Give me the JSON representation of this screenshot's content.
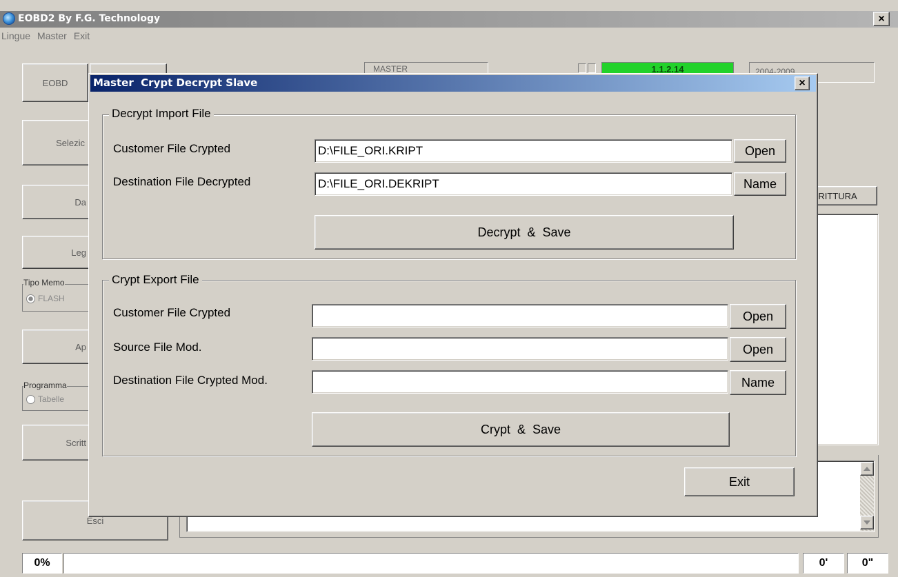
{
  "app": {
    "title": "EOBD2 By F.G. Technology",
    "close_glyph": "×"
  },
  "menu": [
    "Lingue",
    "Master",
    "Exit"
  ],
  "background": {
    "eobd_label": "EOBD",
    "selezio_label": "Selezic",
    "da_label": "Da",
    "leg_label": "Leg",
    "tipo_memoria_label": "Tipo Memo",
    "flash_label": "FLASH",
    "ap_label": "Ap",
    "programma_label": "Programma",
    "tabelle_label": "Tabelle",
    "scritt_label": "Scritt",
    "esci_label": "Esci",
    "master_field": "MASTER",
    "status_field": "1.1.2.14",
    "date_field": "2004-2009",
    "scrittura_tab": "CRITTURA",
    "status_color": "#22d22a"
  },
  "statusbar": {
    "percent": "0%",
    "minutes": "0'",
    "seconds": "0\""
  },
  "dialog": {
    "title": "Master  Crypt Decrypt Slave",
    "decrypt_group": {
      "legend": "Decrypt Import File",
      "customer_label": "Customer File Crypted",
      "customer_value": "D:\\FILE_ORI.KRIPT",
      "customer_button": "Open",
      "dest_label": "Destination File Decrypted",
      "dest_value": "D:\\FILE_ORI.DEKRIPT",
      "dest_button": "Name",
      "action_button": "Decrypt  &  Save"
    },
    "crypt_group": {
      "legend": "Crypt Export File",
      "customer_label": "Customer File Crypted",
      "customer_value": "",
      "customer_button": "Open",
      "source_label": "Source File Mod.",
      "source_value": "",
      "source_button": "Open",
      "dest_label": "Destination File Crypted Mod.",
      "dest_value": "",
      "dest_button": "Name",
      "action_button": "Crypt  &  Save"
    },
    "exit_button": "Exit",
    "titlebar_colors": [
      "#0a246a",
      "#a6caf0"
    ]
  }
}
